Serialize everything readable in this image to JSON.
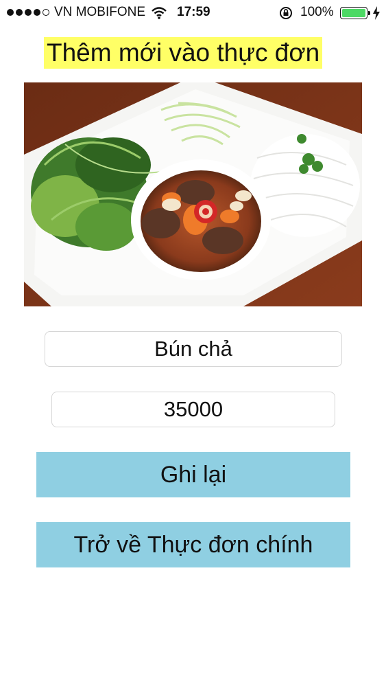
{
  "status_bar": {
    "carrier": "VN MOBIFONE",
    "time": "17:59",
    "battery": "100%",
    "signal_icon": "signal-dots-icon",
    "wifi_icon": "wifi-icon",
    "lock_icon": "orientation-lock-icon",
    "battery_icon": "battery-icon",
    "charging_icon": "charging-bolt-icon"
  },
  "page": {
    "title": "Thêm mới vào thực đơn",
    "title_highlight": "#ffff66"
  },
  "dish": {
    "name": "Bún chả",
    "price": "35000"
  },
  "buttons": {
    "save": "Ghi lại",
    "back": "Trở về Thực đơn chính",
    "color": "#8fcfe2"
  }
}
